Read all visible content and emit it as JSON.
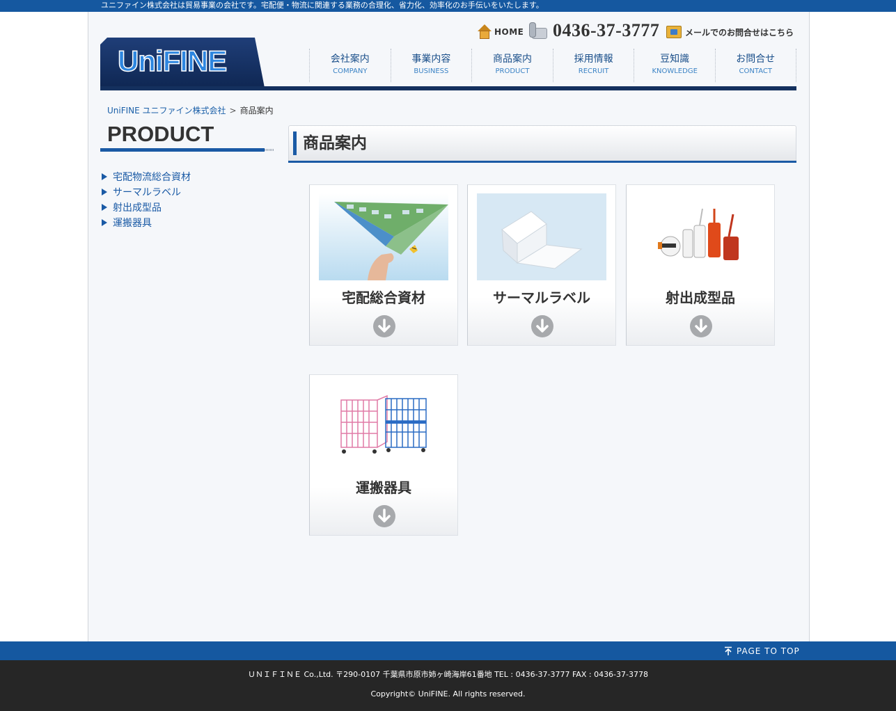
{
  "topbar": {
    "text": "ユニファイン株式会社は貿易事業の会社です。宅配便・物流に関連する業務の合理化、省力化、効率化のお手伝いをいたします。"
  },
  "header": {
    "logo_text": "UniFINE",
    "home_label": "HOME",
    "phone": "0436-37-3777",
    "mail_label": "メールでのお問合せはこちら"
  },
  "nav": {
    "items": [
      {
        "jp": "会社案内",
        "en": "COMPANY"
      },
      {
        "jp": "事業内容",
        "en": "BUSINESS"
      },
      {
        "jp": "商品案内",
        "en": "PRODUCT"
      },
      {
        "jp": "採用情報",
        "en": "RECRUIT"
      },
      {
        "jp": "豆知識",
        "en": "KNOWLEDGE"
      },
      {
        "jp": "お問合せ",
        "en": "CONTACT"
      }
    ]
  },
  "breadcrumb": {
    "home": "UniFINE ユニファイン株式会社",
    "separator": ">",
    "current": "商品案内"
  },
  "sidebar": {
    "title": "PRODUCT",
    "items": [
      {
        "label": "宅配物流総合資材"
      },
      {
        "label": "サーマルラベル"
      },
      {
        "label": "射出成型品"
      },
      {
        "label": "運搬器具"
      }
    ]
  },
  "content": {
    "heading": "商品案内",
    "cards": [
      {
        "caption": "宅配総合資材",
        "image_icon": "paper-plane-image"
      },
      {
        "caption": "サーマルラベル",
        "image_icon": "thermal-label-roll-image"
      },
      {
        "caption": "射出成型品",
        "image_icon": "plastic-seal-tags-image"
      },
      {
        "caption": "運搬器具",
        "image_icon": "roll-cage-carts-image"
      }
    ]
  },
  "footer": {
    "page_top": "PAGE TO TOP",
    "address": "ＵＮＩＦＩＮＥ Co.,Ltd. 〒290-0107 千葉県市原市姉ヶ崎海岸61番地 TEL : 0436-37-3777 FAX : 0436-37-3778",
    "copyright": "Copyright© UniFINE. All rights reserved."
  },
  "colors": {
    "brand_blue": "#1558a0",
    "navy": "#14305e",
    "footer_dark": "#262626"
  }
}
